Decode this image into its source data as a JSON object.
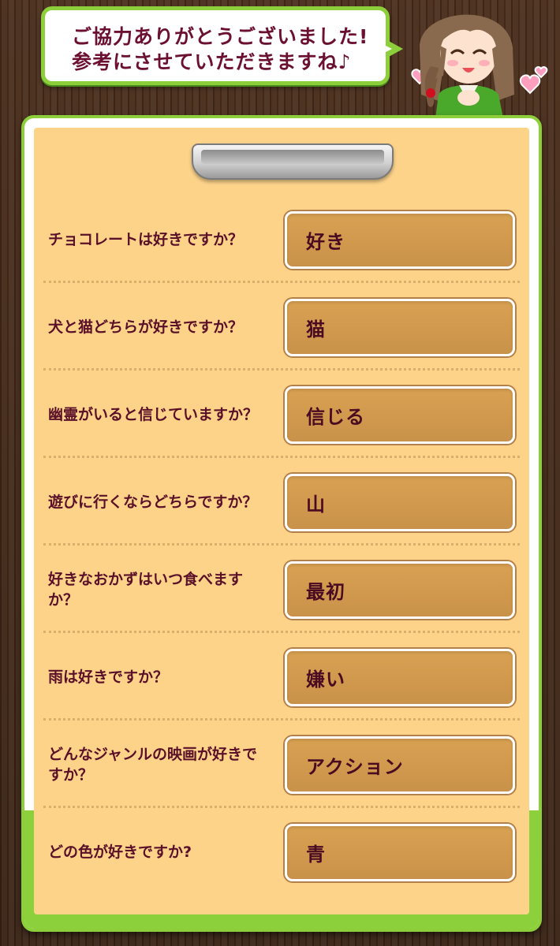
{
  "bubble": {
    "line1": "ご協力ありがとうございました!",
    "line2": "参考にさせていただきますね♪"
  },
  "colors": {
    "accent_green": "#8ccf3a",
    "text_maroon": "#6b1030",
    "paper": "#fdd38a",
    "answer_box": "#c9924a"
  },
  "survey": {
    "items": [
      {
        "question": "チョコレートは好きですか？",
        "answer": "好き"
      },
      {
        "question": "犬と猫どちらが好きですか？",
        "answer": "猫"
      },
      {
        "question": "幽霊がいると信じていますか？",
        "answer": "信じる"
      },
      {
        "question": "遊びに行くならどちらですか？",
        "answer": "山"
      },
      {
        "question": "好きなおかずはいつ食べますか？",
        "answer": "最初"
      },
      {
        "question": "雨は好きですか？",
        "answer": "嫌い"
      },
      {
        "question": "どんなジャンルの映画が好きですか？",
        "answer": "アクション"
      },
      {
        "question": "どの色が好きですか?",
        "answer": "青"
      }
    ]
  }
}
